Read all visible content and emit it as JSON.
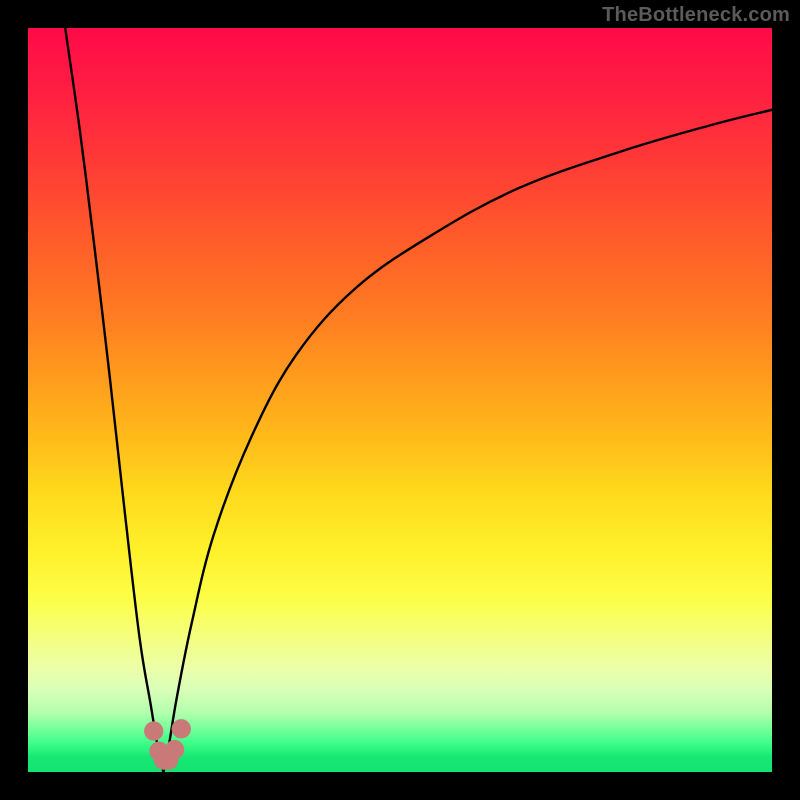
{
  "watermark": "TheBottleneck.com",
  "colors": {
    "frame": "#000000",
    "gradient_top": "#ff0a47",
    "gradient_bottom": "#13e372",
    "curve": "#000000",
    "dots": "#c97a78"
  },
  "chart_data": {
    "type": "line",
    "title": "",
    "xlabel": "",
    "ylabel": "",
    "xlim": [
      0,
      100
    ],
    "ylim": [
      0,
      100
    ],
    "grid": false,
    "legend": false,
    "notes": "Axes are implied (no visible ticks). Values are read as percentages of plot width/height with origin at bottom-left. Two curves descend into a narrow V near x≈18, y≈0; the right branch rises asymptotically toward ~y≈90.",
    "series": [
      {
        "name": "left-branch",
        "x": [
          5,
          7,
          9,
          11,
          13,
          15,
          16.5,
          17.5,
          18.2
        ],
        "y": [
          100,
          86,
          70,
          53,
          35,
          18,
          9,
          3,
          0
        ]
      },
      {
        "name": "right-branch",
        "x": [
          18.2,
          19,
          20,
          22,
          25,
          30,
          36,
          44,
          54,
          66,
          80,
          92,
          100
        ],
        "y": [
          0,
          4,
          10,
          20,
          32,
          45,
          56,
          65,
          72,
          78.5,
          83.5,
          87,
          89
        ]
      }
    ],
    "markers": [
      {
        "name": "dot-left-upper",
        "x": 16.9,
        "y": 5.5,
        "r": 1.3
      },
      {
        "name": "dot-left-lower",
        "x": 17.6,
        "y": 2.8,
        "r": 1.3
      },
      {
        "name": "dot-bottom-a",
        "x": 18.2,
        "y": 1.6,
        "r": 1.3
      },
      {
        "name": "dot-bottom-b",
        "x": 18.9,
        "y": 1.6,
        "r": 1.3
      },
      {
        "name": "dot-right-lower",
        "x": 19.7,
        "y": 3.0,
        "r": 1.3
      },
      {
        "name": "dot-right-upper",
        "x": 20.6,
        "y": 5.8,
        "r": 1.3
      }
    ]
  }
}
